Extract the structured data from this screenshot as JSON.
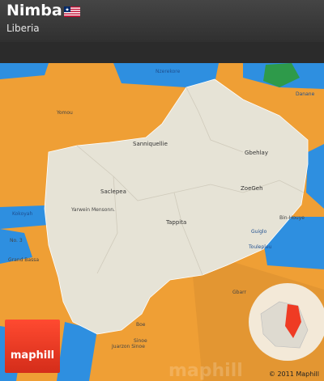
{
  "header": {
    "title": "Nimba",
    "subtitle": "Liberia"
  },
  "map": {
    "labels": [
      {
        "text": "Nimba",
        "key": "sanniquellie",
        "value": "Sanniquellie"
      },
      {
        "text": "Saclepea"
      },
      {
        "text": "Gbehlay"
      },
      {
        "text": "ZoeGeh"
      },
      {
        "text": "Tappita"
      },
      {
        "text": "Yarwein Mensonn."
      },
      {
        "text": "Nzerekore"
      },
      {
        "text": "Yomou"
      },
      {
        "text": "Kokoyah"
      },
      {
        "text": "No. 3"
      },
      {
        "text": "Grand Bassa"
      },
      {
        "text": "Gbarr"
      },
      {
        "text": "Boe"
      },
      {
        "text": "Sinoe"
      },
      {
        "text": "Juarzon Sinoe"
      },
      {
        "text": "Danane"
      },
      {
        "text": "Bin-Houye"
      },
      {
        "text": "Guiglo"
      },
      {
        "text": "Toulepleu"
      }
    ]
  },
  "brand": {
    "logo_text": "maphill",
    "watermark": "maphill",
    "copyright": "© 2011 Maphill"
  },
  "colors": {
    "county": "#e6e3d6",
    "neighbors": "#f0a63a",
    "water": "#2e8fe0",
    "forest": "#2e9a4a",
    "guinea_tint": "#e09a38",
    "logo": "#ef3b24"
  }
}
